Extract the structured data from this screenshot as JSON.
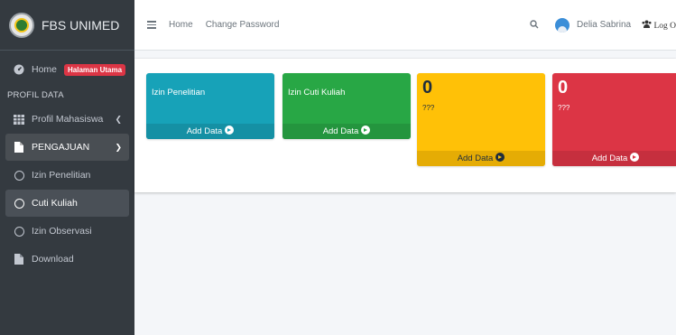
{
  "brand": {
    "name": "FBS UNIMED"
  },
  "sidebar": {
    "items": [
      {
        "label": "Home",
        "badge": "Halaman Utama",
        "icon": "dashboard-icon"
      },
      {
        "header": "PROFIL DATA"
      },
      {
        "label": "Profil Mahasiswa",
        "icon": "table-icon"
      },
      {
        "label": "PENGAJUAN",
        "icon": "file-icon"
      },
      {
        "label": "Izin Penelitian",
        "icon": "circle-icon"
      },
      {
        "label": "Cuti Kuliah",
        "icon": "circle-icon"
      },
      {
        "label": "Izin Observasi",
        "icon": "circle-icon"
      },
      {
        "label": "Download",
        "icon": "file-icon"
      }
    ]
  },
  "navbar": {
    "home": "Home",
    "change_password": "Change Password",
    "user_name": "Delia Sabrina",
    "logout": "Log O"
  },
  "boxes": [
    {
      "title": "Izin Penelitian",
      "footer": "Add Data",
      "color": "#17a2b8"
    },
    {
      "title": "Izin Cuti Kuliah",
      "footer": "Add Data",
      "color": "#28a745"
    },
    {
      "number": "0",
      "sub": "???",
      "footer": "Add Data",
      "color": "#ffc107"
    },
    {
      "number": "0",
      "sub": "???",
      "footer": "Add Data",
      "color": "#dc3545"
    }
  ]
}
